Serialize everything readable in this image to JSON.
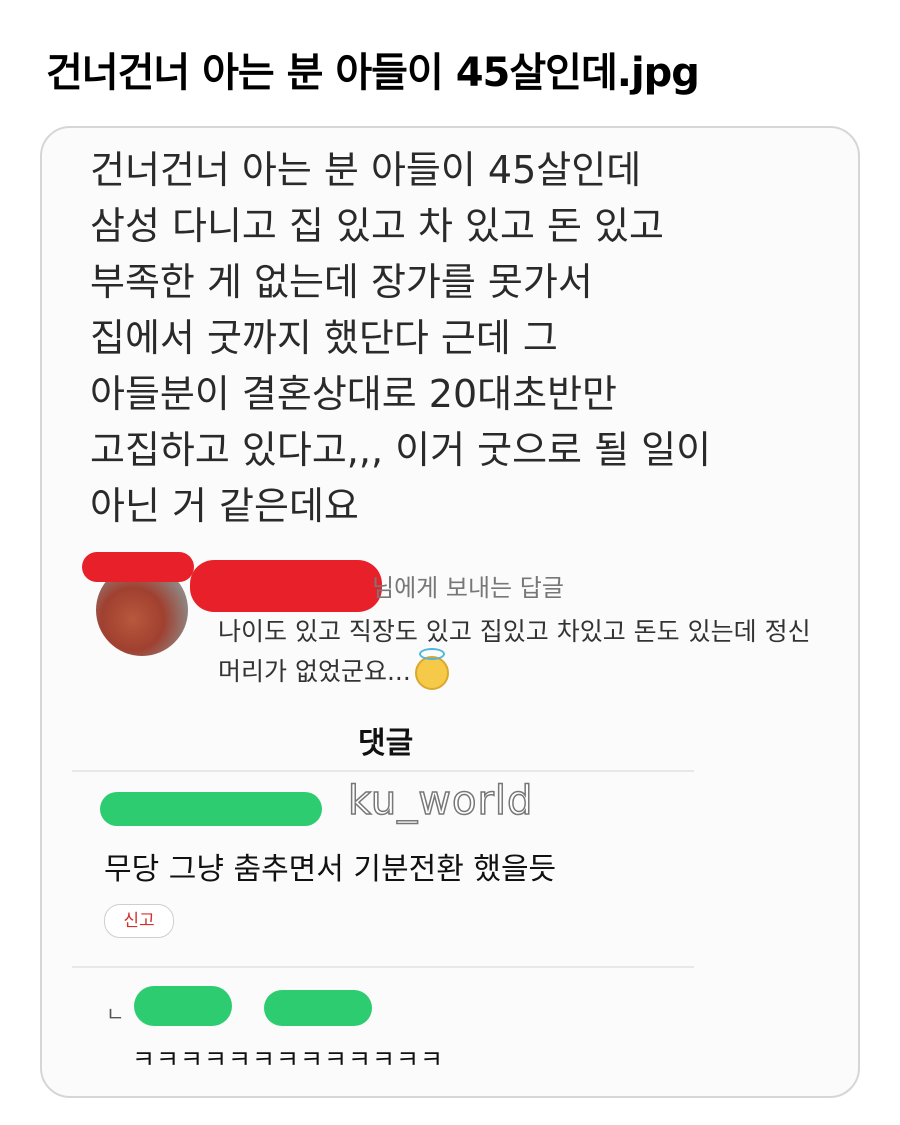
{
  "title": "건너건너 아는 분 아들이 45살인데.jpg",
  "post": {
    "lines": [
      "건너건너 아는 분 아들이 45살인데",
      "삼성 다니고 집 있고 차 있고 돈 있고",
      "부족한 게 없는데 장가를 못가서",
      "집에서 굿까지 했단다 근데 그",
      "아들분이 결혼상대로 20대초반만",
      "고집하고 있다고,,, 이거 굿으로 될 일이",
      "아닌 거 같은데요"
    ]
  },
  "reply": {
    "to_suffix": "님에게 보내는 답글",
    "body": "나이도 있고 직장도 있고 집있고 차있고 돈도 있는데 정신머리가 없었군요...",
    "emoji": "smiling-face-with-halo"
  },
  "comments_section": {
    "title": "댓글",
    "watermark": "ku_world",
    "comment_text": "무당 그냥 춤추면서 기분전환 했을듯",
    "report_label": "신고",
    "reply_mark": "ㄴ",
    "reply_text": "ㅋㅋㅋㅋㅋㅋㅋㅋㅋㅋㅋㅋㅋ"
  },
  "colors": {
    "redaction_red": "#e8202a",
    "redaction_green": "#2ecc71",
    "report_text": "#d13030"
  }
}
